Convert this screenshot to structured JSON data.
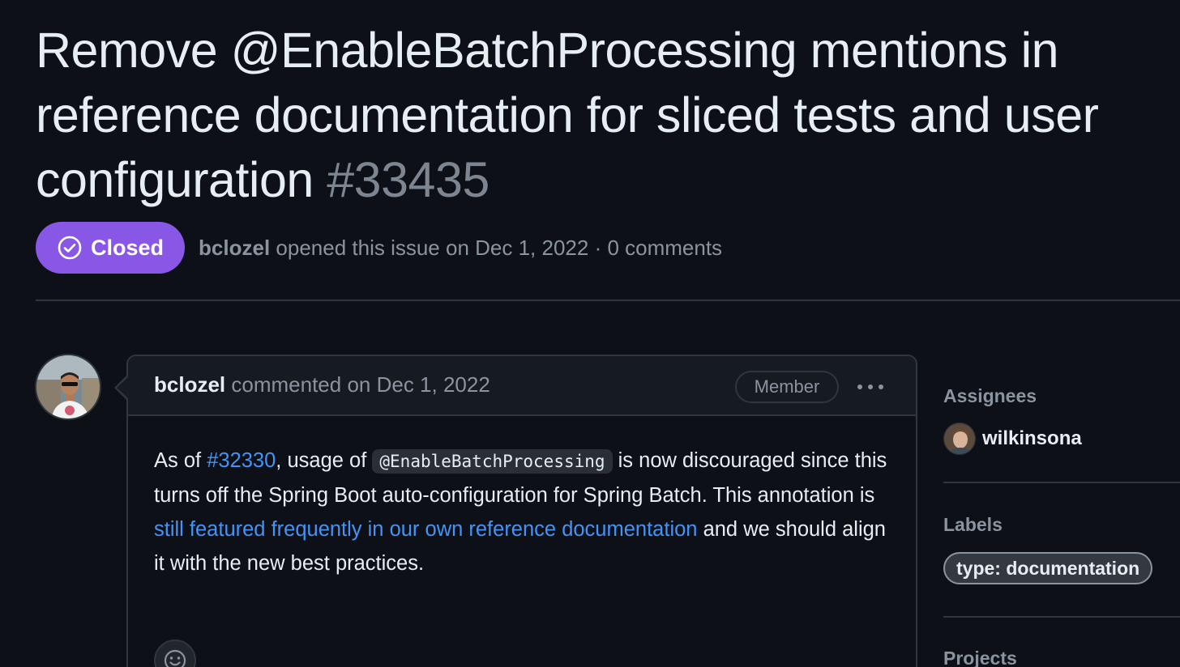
{
  "issue": {
    "title": "Remove @EnableBatchProcessing mentions in reference documentation for sliced tests and user configuration",
    "number": "#33435",
    "state_label": "Closed",
    "state_color": "#8957e5",
    "opened_by": "bclozel",
    "opened_text": "opened this issue on Dec 1, 2022 · 0 comments"
  },
  "comment": {
    "author": "bclozel",
    "commented_text": "commented on Dec 1, 2022",
    "role_badge": "Member",
    "more_icon": "kebab-horizontal-icon",
    "body": {
      "part1": "As of ",
      "link1": "#32330",
      "part2": ", usage of ",
      "code": "@EnableBatchProcessing",
      "part3": " is now discouraged since this turns off the Spring Boot auto-configuration for Spring Batch. This annotation is ",
      "link2": "still featured frequently in our own reference documentation",
      "part4": " and we should align it with the new best practices."
    },
    "reaction_icon": "smiley-icon"
  },
  "sidebar": {
    "assignees_heading": "Assignees",
    "assignee_name": "wilkinsona",
    "labels_heading": "Labels",
    "label": "type: documentation",
    "projects_heading": "Projects"
  },
  "colors": {
    "background": "#0d1117",
    "link": "#4493f8",
    "muted": "#8b949e",
    "closed_purple": "#8957e5"
  }
}
